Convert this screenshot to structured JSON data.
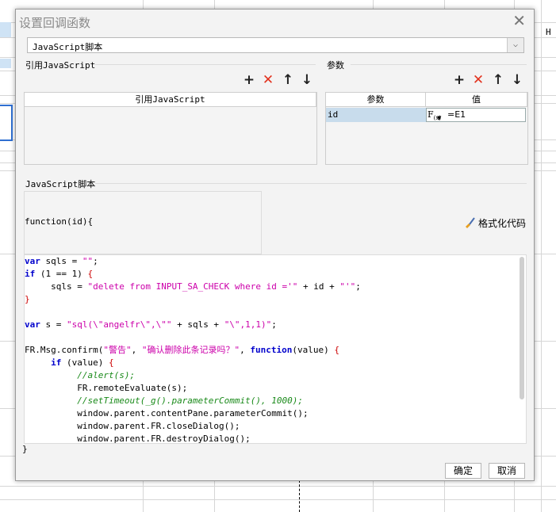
{
  "background": {
    "column_header_h": "H"
  },
  "dialog": {
    "title": "设置回调函数",
    "close_glyph": "✕",
    "type_select": {
      "value": "JavaScript脚本"
    },
    "ref_js": {
      "section_label": "引用JavaScript",
      "column_header": "引用JavaScript"
    },
    "params": {
      "section_label": "参数",
      "header_name": "参数",
      "header_value": "值",
      "rows": [
        {
          "name": "id",
          "value": "=E1"
        }
      ]
    },
    "script": {
      "section_label": "JavaScript脚本",
      "function_signature": "function(id){",
      "format_label": "格式化代码",
      "closing_brace": "}"
    },
    "buttons": {
      "ok": "确定",
      "cancel": "取消"
    }
  },
  "code_lines": [
    "var sqls = \"\";",
    "if (1 == 1) {",
    "     sqls = \"delete from INPUT_SA_CHECK where id ='\" + id + \"'\";",
    "}",
    "",
    "var s = \"sql(\\\"angelfr\\\",\\\"\" + sqls + \"\\\",1,1)\";",
    "",
    "FR.Msg.confirm(\"警告\", \"确认删除此条记录吗？\", function(value) {",
    "     if (value) {",
    "          //alert(s);",
    "          FR.remoteEvaluate(s);",
    "          //setTimeout(_g().parameterCommit(), 1000);",
    "          window.parent.contentPane.parameterCommit();",
    "          window.parent.FR.closeDialog();",
    "          window.parent.FR.destroyDialog();"
  ],
  "colors": {
    "keyword": "#0000cc",
    "string": "#cc00aa",
    "comment": "#1a8a1a",
    "delete_icon": "#e2321e",
    "selected_cell": "#c8dcec"
  }
}
